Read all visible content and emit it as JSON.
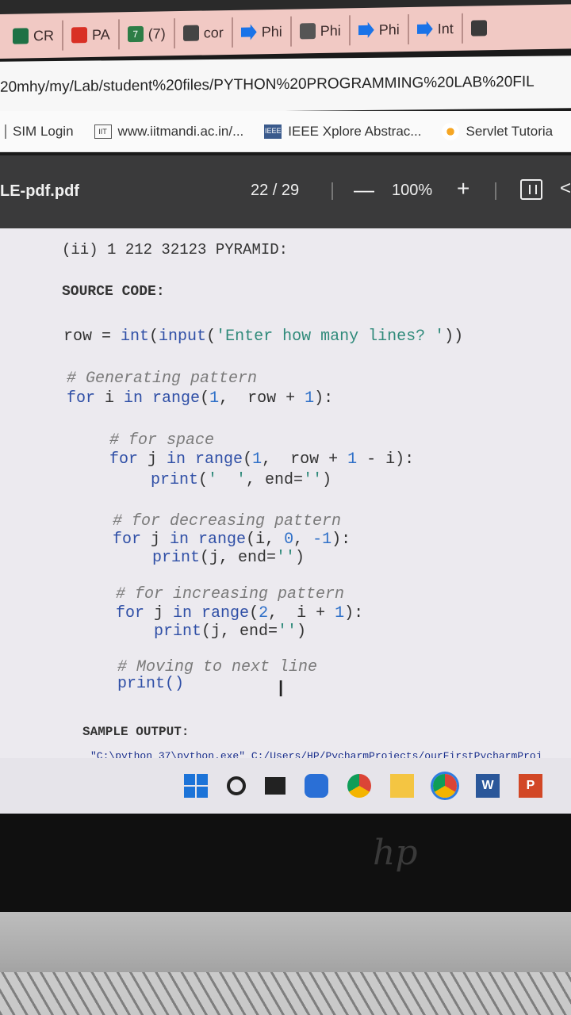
{
  "browser": {
    "tabs": [
      {
        "label": "CR",
        "icon": "excel-icon"
      },
      {
        "label": "PA",
        "icon": "gmail-icon"
      },
      {
        "label": "(7)",
        "icon": "notification-icon"
      },
      {
        "label": "cor",
        "icon": "globe-icon"
      },
      {
        "label": "Phi",
        "icon": "meet-arrow-icon"
      },
      {
        "label": "Phi",
        "icon": "site-icon"
      },
      {
        "label": "Phi",
        "icon": "meet-arrow-icon"
      },
      {
        "label": "Int",
        "icon": "meet-arrow-icon"
      }
    ],
    "tab_counter": "7",
    "address": "20mhy/my/Lab/student%20files/PYTHON%20PROGRAMMING%20LAB%20FIL",
    "bookmarks": [
      {
        "label": "SIM Login",
        "icon": "separator"
      },
      {
        "label": "www.iitmandi.ac.in/...",
        "icon": "iit-icon"
      },
      {
        "label": "IEEE Xplore Abstrac...",
        "icon": "ieee-icon"
      },
      {
        "label": "Servlet Tutoria",
        "icon": "servlet-icon"
      }
    ],
    "iit_badge": "IIT",
    "ieee_badge": "IEEE"
  },
  "pdf_toolbar": {
    "title": "LE-pdf.pdf",
    "page_indicator": "22  /  29",
    "zoom_out": "—",
    "zoom": "100%",
    "zoom_in": "+",
    "rotate": "<"
  },
  "document": {
    "section_title": "(ii) 1 212 32123 PYRAMID:",
    "source_heading": "SOURCE CODE:",
    "code": {
      "l1_a": "row = ",
      "l1_b": "int",
      "l1_c": "(",
      "l1_d": "input",
      "l1_e": "(",
      "l1_f": "'Enter how many lines? '",
      "l1_g": "))",
      "c1": "# Generating pattern",
      "l2_a": "for",
      "l2_b": " i ",
      "l2_c": "in",
      "l2_d": " range",
      "l2_e": "(",
      "l2_f": "1",
      "l2_g": ",  row + ",
      "l2_h": "1",
      "l2_i": "):",
      "c2": "# for space",
      "l3_a": "for",
      "l3_b": " j ",
      "l3_c": "in",
      "l3_d": " range",
      "l3_e": "(",
      "l3_f": "1",
      "l3_g": ",  row + ",
      "l3_h": "1",
      "l3_i": " - i):",
      "l4_a": "print",
      "l4_b": "(",
      "l4_c": "'  '",
      "l4_d": ", end=",
      "l4_e": "''",
      "l4_f": ")",
      "c3": "# for decreasing pattern",
      "l5_a": "for",
      "l5_b": " j ",
      "l5_c": "in",
      "l5_d": " range",
      "l5_e": "(i, ",
      "l5_f": "0",
      "l5_g": ", ",
      "l5_h": "-1",
      "l5_i": "):",
      "l6_a": "print",
      "l6_b": "(j, end=",
      "l6_c": "''",
      "l6_d": ")",
      "c4": "# for increasing pattern",
      "l7_a": "for",
      "l7_b": " j ",
      "l7_c": "in",
      "l7_d": " range",
      "l7_e": "(",
      "l7_f": "2",
      "l7_g": ",  i + ",
      "l7_h": "1",
      "l7_i": "):",
      "l8_a": "print",
      "l8_b": "(j, end=",
      "l8_c": "''",
      "l8_d": ")",
      "c5": "# Moving to next line",
      "l9": "print()"
    },
    "sample_heading": "SAMPLE OUTPUT:",
    "console_cmd": "\"C:\\python 37\\python.exe\" C:/Users/HP/PycharmProjects/ourFirstPycharmProj",
    "cursor": "I"
  },
  "taskbar": {
    "word": "W",
    "ppt": "P"
  },
  "laptop": {
    "brand": "hp"
  }
}
